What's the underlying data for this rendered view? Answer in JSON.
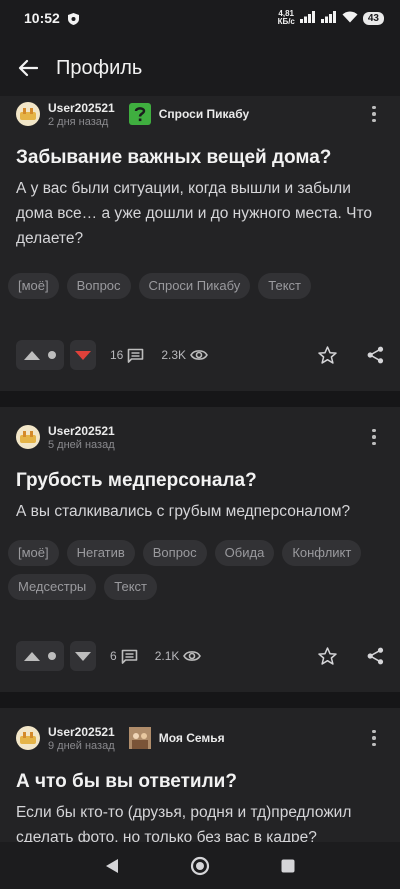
{
  "status": {
    "time": "10:52",
    "speed_top": "4,81",
    "speed_bottom": "КБ/с",
    "battery": "43"
  },
  "header": {
    "title": "Профиль"
  },
  "posts": [
    {
      "author": "User202521",
      "date": "2 дня назад",
      "community": "Спроси Пикабу",
      "title": "Забывание важных вещей дома?",
      "text": "А у вас были ситуации, когда вышли и забыли дома все… а уже дошли и до нужного места. Что делаете?",
      "tags": [
        "[моё]",
        "Вопрос",
        "Спроси Пикабу",
        "Текст"
      ],
      "comments": "16",
      "views": "2.3K"
    },
    {
      "author": "User202521",
      "date": "5 дней назад",
      "community": "",
      "title": "Грубость медперсонала?",
      "text": "А вы сталкивались с грубым медперсоналом?",
      "tags": [
        "[моё]",
        "Негатив",
        "Вопрос",
        "Обида",
        "Конфликт",
        "Медсестры",
        "Текст"
      ],
      "comments": "6",
      "views": "2.1K"
    },
    {
      "author": "User202521",
      "date": "9 дней назад",
      "community": "Моя Семья",
      "title": "А что бы вы ответили?",
      "text": "Если бы кто-то (друзья, родня и тд)предложил сделать фото, но только без вас в кадре?"
    }
  ],
  "colors": {
    "accent_green": "#3fae3f",
    "downvote_red": "#e0413a",
    "background": "#1b1b1d",
    "card": "#232325"
  },
  "icons": [
    "back-arrow-icon",
    "kebab-menu-icon",
    "upvote-icon",
    "downvote-icon",
    "comment-icon",
    "eye-icon",
    "star-icon",
    "share-icon"
  ]
}
